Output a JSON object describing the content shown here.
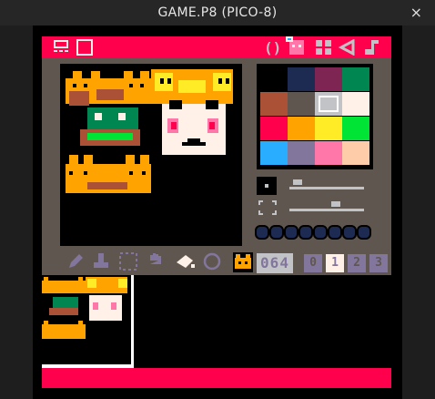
{
  "window": {
    "title": "GAME.P8 (PICO-8)",
    "close_glyph": "×"
  },
  "colors": {
    "accent": "#ff004d",
    "panel": "#5f574f",
    "palette": [
      "#000000",
      "#1d2b53",
      "#7e2553",
      "#008751",
      "#ab5236",
      "#5f574f",
      "#c2c3c7",
      "#fff1e8",
      "#ff004d",
      "#ffa300",
      "#ffec27",
      "#00e436",
      "#29adff",
      "#83769c",
      "#ff77a8",
      "#ffccaa"
    ],
    "selected_color_index": 6
  },
  "top_bar": {
    "left_icons": [
      "sprite-editor-icon",
      "map-editor-icon"
    ],
    "right_icons": [
      "code-editor-icon",
      "sprite-editor-tab-icon",
      "map-editor-tab-icon",
      "sfx-editor-icon",
      "music-editor-icon"
    ]
  },
  "tools": [
    "pencil-icon",
    "stamp-icon",
    "select-icon",
    "pan-icon",
    "fill-icon",
    "circle-icon"
  ],
  "sprite": {
    "number": "064"
  },
  "sheet_tabs": [
    "0",
    "1",
    "2",
    "3"
  ],
  "active_sheet_tab": 1
}
